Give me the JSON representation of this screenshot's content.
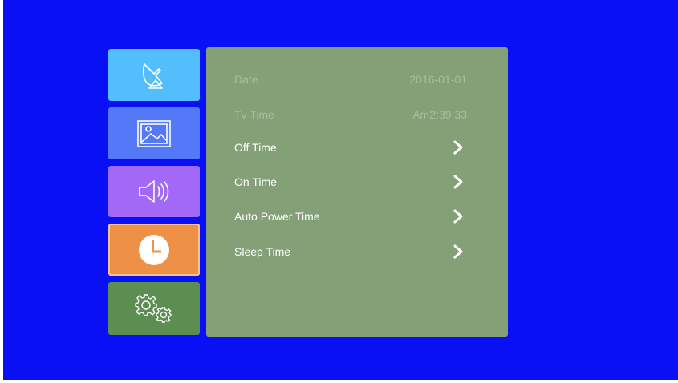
{
  "sidebar": {
    "items": [
      {
        "name": "satellite-dish-icon"
      },
      {
        "name": "picture-icon"
      },
      {
        "name": "speaker-icon"
      },
      {
        "name": "clock-icon",
        "selected": true
      },
      {
        "name": "gears-icon"
      }
    ]
  },
  "panel": {
    "date": {
      "label": "Date",
      "value": "2016-01-01"
    },
    "tv_time": {
      "label": "Tv Time",
      "value": "Am2:39:33"
    },
    "off_time": {
      "label": "Off Time"
    },
    "on_time": {
      "label": "On Time"
    },
    "auto_power_time": {
      "label": "Auto Power Time"
    },
    "sleep_time": {
      "label": "Sleep Time"
    }
  },
  "colors": {
    "background": "#0a10f4",
    "panel": "#83a077",
    "disabled_text": "#a5c09b",
    "tab_satellite": "#52bffc",
    "tab_picture": "#5479f8",
    "tab_sound": "#a268f6",
    "tab_time": "#ee9146",
    "tab_settings": "#5c8d51"
  }
}
